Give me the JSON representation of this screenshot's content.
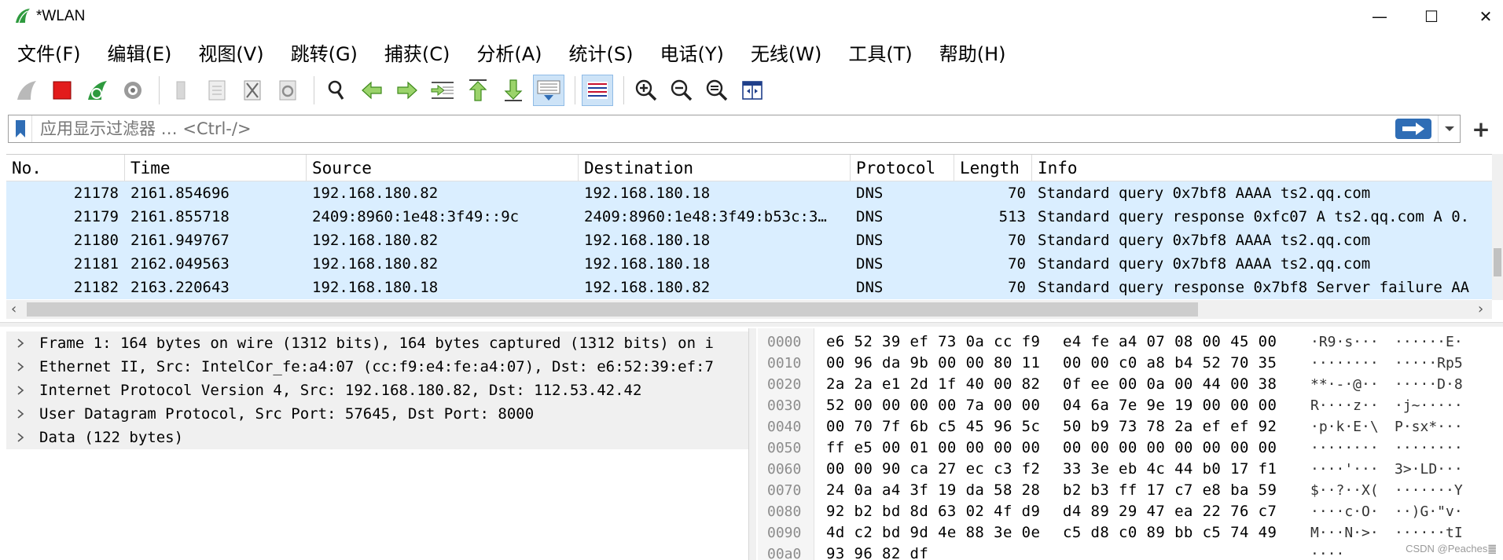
{
  "window": {
    "title": "*WLAN",
    "controls": {
      "minimize": "—",
      "maximize": "☐",
      "close": "✕"
    }
  },
  "menu": [
    "文件(F)",
    "编辑(E)",
    "视图(V)",
    "跳转(G)",
    "捕获(C)",
    "分析(A)",
    "统计(S)",
    "电话(Y)",
    "无线(W)",
    "工具(T)",
    "帮助(H)"
  ],
  "toolbar": {
    "icons": [
      "shark-fin-start-icon",
      "stop-icon",
      "restart-icon",
      "capture-options-gear-icon",
      "open-file-icon",
      "save-file-icon",
      "close-file-icon",
      "reload-icon",
      "find-packet-icon",
      "go-back-icon",
      "go-forward-icon",
      "go-to-packet-icon",
      "first-packet-icon",
      "last-packet-icon",
      "auto-scroll-icon",
      "colorize-icon",
      "zoom-in-icon",
      "zoom-out-icon",
      "zoom-normal-icon",
      "resize-columns-icon"
    ],
    "active": [
      "auto-scroll-icon",
      "colorize-icon"
    ]
  },
  "filter": {
    "placeholder": "应用显示过滤器 … <Ctrl-/>",
    "value": "",
    "plus": "+"
  },
  "packet_list": {
    "columns": [
      "No.",
      "Time",
      "Source",
      "Destination",
      "Protocol",
      "Length",
      "Info"
    ],
    "rows": [
      {
        "no": "21178",
        "time": "2161.854696",
        "src": "192.168.180.82",
        "dst": "192.168.180.18",
        "proto": "DNS",
        "len": "70",
        "info": "Standard query 0x7bf8 AAAA ts2.qq.com"
      },
      {
        "no": "21179",
        "time": "2161.855718",
        "src": "2409:8960:1e48:3f49::9c",
        "dst": "2409:8960:1e48:3f49:b53c:3…",
        "proto": "DNS",
        "len": "513",
        "info": "Standard query response 0xfc07 A ts2.qq.com A 0."
      },
      {
        "no": "21180",
        "time": "2161.949767",
        "src": "192.168.180.82",
        "dst": "192.168.180.18",
        "proto": "DNS",
        "len": "70",
        "info": "Standard query 0x7bf8 AAAA ts2.qq.com"
      },
      {
        "no": "21181",
        "time": "2162.049563",
        "src": "192.168.180.82",
        "dst": "192.168.180.18",
        "proto": "DNS",
        "len": "70",
        "info": "Standard query 0x7bf8 AAAA ts2.qq.com"
      },
      {
        "no": "21182",
        "time": "2163.220643",
        "src": "192.168.180.18",
        "dst": "192.168.180.82",
        "proto": "DNS",
        "len": "70",
        "info": "Standard query response 0x7bf8 Server failure AA"
      }
    ]
  },
  "details": [
    "Frame 1: 164 bytes on wire (1312 bits), 164 bytes captured (1312 bits) on i",
    "Ethernet II, Src: IntelCor_fe:a4:07 (cc:f9:e4:fe:a4:07), Dst: e6:52:39:ef:7",
    "Internet Protocol Version 4, Src: 192.168.180.82, Dst: 112.53.42.42",
    "User Datagram Protocol, Src Port: 57645, Dst Port: 8000",
    "Data (122 bytes)"
  ],
  "hex": [
    {
      "off": "0000",
      "b1": "e6 52 39 ef 73 0a cc f9",
      "b2": "e4 fe a4 07 08 00 45 00",
      "a1": "·R9·s···",
      "a2": "······E·"
    },
    {
      "off": "0010",
      "b1": "00 96 da 9b 00 00 80 11",
      "b2": "00 00 c0 a8 b4 52 70 35",
      "a1": "········",
      "a2": "·····Rp5"
    },
    {
      "off": "0020",
      "b1": "2a 2a e1 2d 1f 40 00 82",
      "b2": "0f ee 00 0a 00 44 00 38",
      "a1": "**·-·@··",
      "a2": "·····D·8"
    },
    {
      "off": "0030",
      "b1": "52 00 00 00 00 7a 00 00",
      "b2": "04 6a 7e 9e 19 00 00 00",
      "a1": "R····z··",
      "a2": "·j~·····"
    },
    {
      "off": "0040",
      "b1": "00 70 7f 6b c5 45 96 5c",
      "b2": "50 b9 73 78 2a ef ef 92",
      "a1": "·p·k·E·\\",
      "a2": "P·sx*···"
    },
    {
      "off": "0050",
      "b1": "ff e5 00 01 00 00 00 00",
      "b2": "00 00 00 00 00 00 00 00",
      "a1": "········",
      "a2": "········"
    },
    {
      "off": "0060",
      "b1": "00 00 90 ca 27 ec c3 f2",
      "b2": "33 3e eb 4c 44 b0 17 f1",
      "a1": "····'···",
      "a2": "3>·LD···"
    },
    {
      "off": "0070",
      "b1": "24 0a a4 3f 19 da 58 28",
      "b2": "b2 b3 ff 17 c7 e8 ba 59",
      "a1": "$··?··X(",
      "a2": "·······Y"
    },
    {
      "off": "0080",
      "b1": "92 b2 bd 8d 63 02 4f d9",
      "b2": "d4 89 29 47 ea 22 76 c7",
      "a1": "····c·O·",
      "a2": "··)G·\"v·"
    },
    {
      "off": "0090",
      "b1": "4d c2 bd 9d 4e 88 3e 0e",
      "b2": "c5 d8 c0 89 bb c5 74 49",
      "a1": "M···N·>·",
      "a2": "······tI"
    },
    {
      "off": "00a0",
      "b1": "93 96 82 df",
      "b2": "",
      "a1": "····",
      "a2": ""
    }
  ],
  "watermark": "CSDN @Peaches䷀"
}
